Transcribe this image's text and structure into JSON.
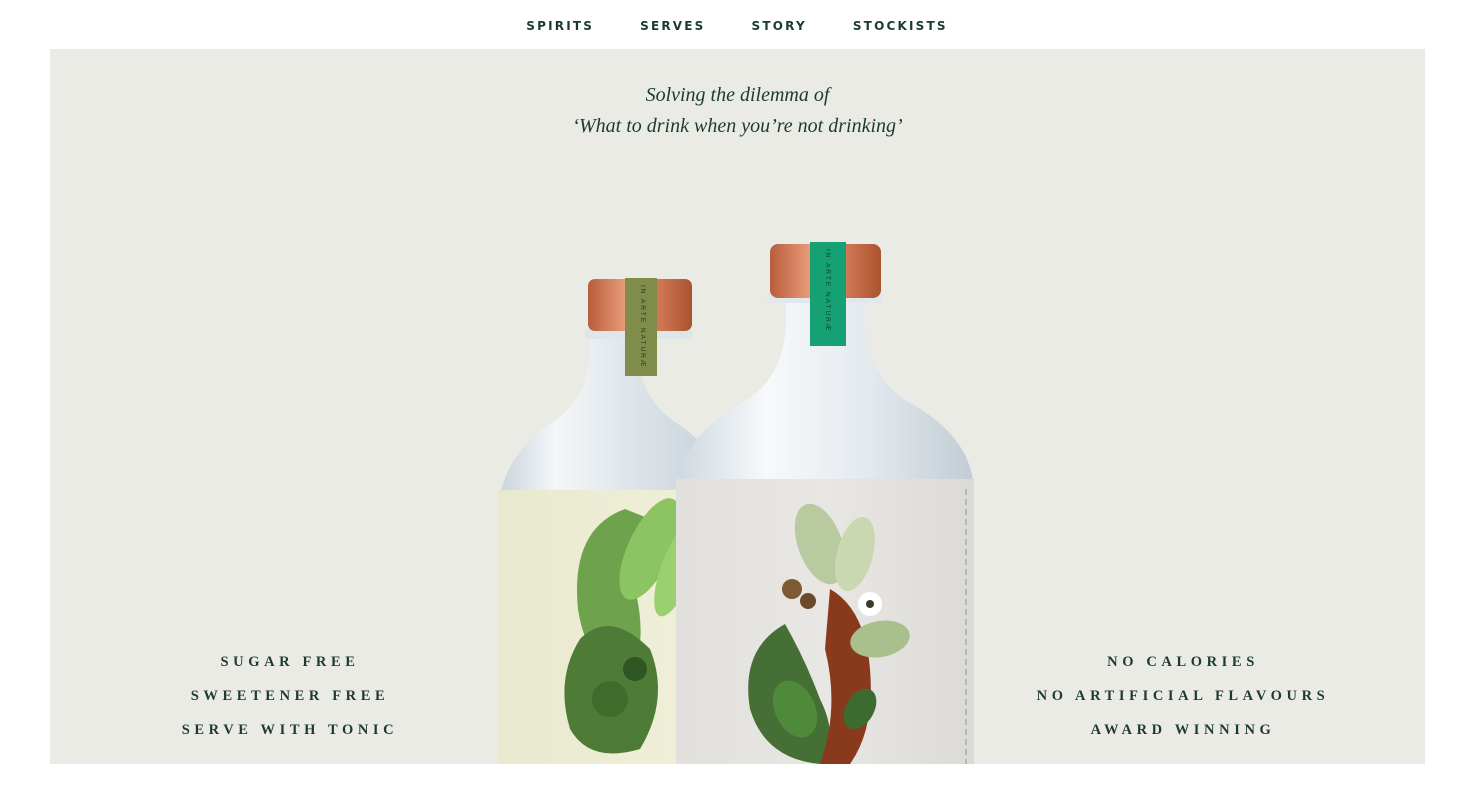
{
  "nav": {
    "items": [
      {
        "label": "SPIRITS"
      },
      {
        "label": "SERVES"
      },
      {
        "label": "STORY"
      },
      {
        "label": "STOCKISTS"
      }
    ]
  },
  "hero": {
    "tagline_line1": "Solving the dilemma of",
    "tagline_line2": "‘What to drink when you’re not drinking’",
    "features_left": [
      "SUGAR FREE",
      "SWEETENER FREE",
      "SERVE WITH TONIC"
    ],
    "features_right": [
      "NO CALORIES",
      "NO ARTIFICIAL FLAVOURS",
      "AWARD WINNING"
    ],
    "bottle_seal_text": "IN ARTE NATURÆ"
  },
  "colors": {
    "text": "#1d3a30",
    "hero_bg": "#ebebe6",
    "cap_copper": "#d07a58",
    "seal_olive": "#7f8c4a",
    "seal_green": "#15a173"
  }
}
